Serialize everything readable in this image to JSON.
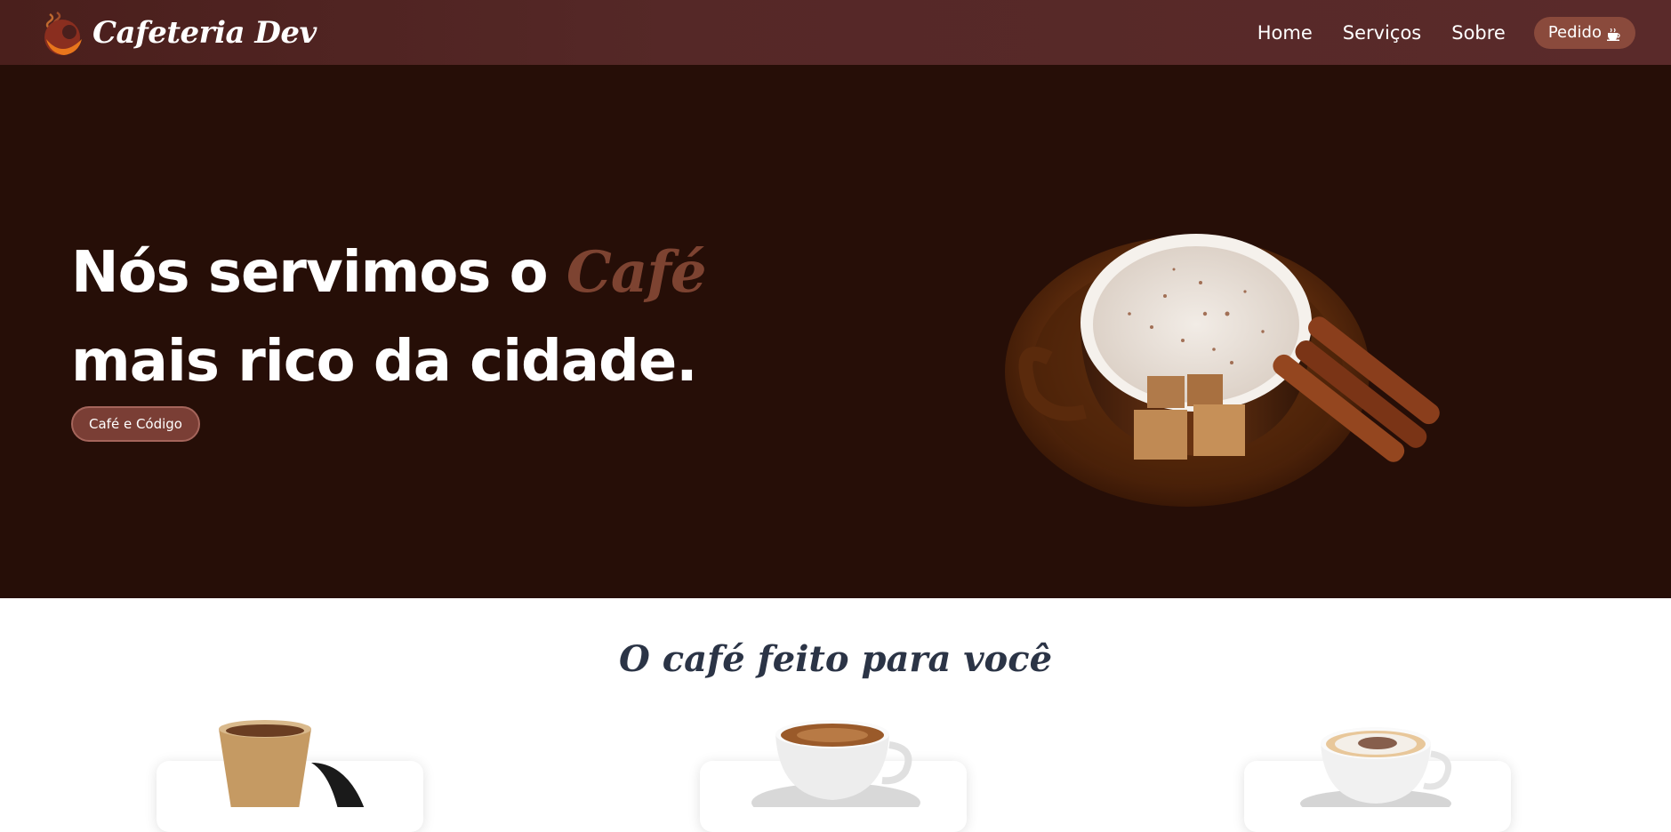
{
  "brand": {
    "name": "Cafeteria Dev",
    "logo_icon": "coffee-logo-icon"
  },
  "nav": {
    "links": [
      "Home",
      "Serviços",
      "Sobre"
    ],
    "order_label": "Pedido",
    "order_icon": "coffee-cup-icon"
  },
  "hero": {
    "title_before": "Nós servimos o ",
    "title_accent": "Café",
    "title_after": " mais rico da cidade.",
    "button_label": "Café e Código",
    "image": "coffee-cup-with-cinnamon-image"
  },
  "section": {
    "title": "O café feito para você",
    "products": [
      {
        "image": "paper-coffee-cup-image"
      },
      {
        "image": "espresso-cup-image"
      },
      {
        "image": "cappuccino-cup-image"
      }
    ]
  },
  "colors": {
    "header": "#552827",
    "hero_bg": "#260e07",
    "accent": "#7d4331",
    "button": "#7a3e35",
    "section_title": "#2b3446"
  }
}
